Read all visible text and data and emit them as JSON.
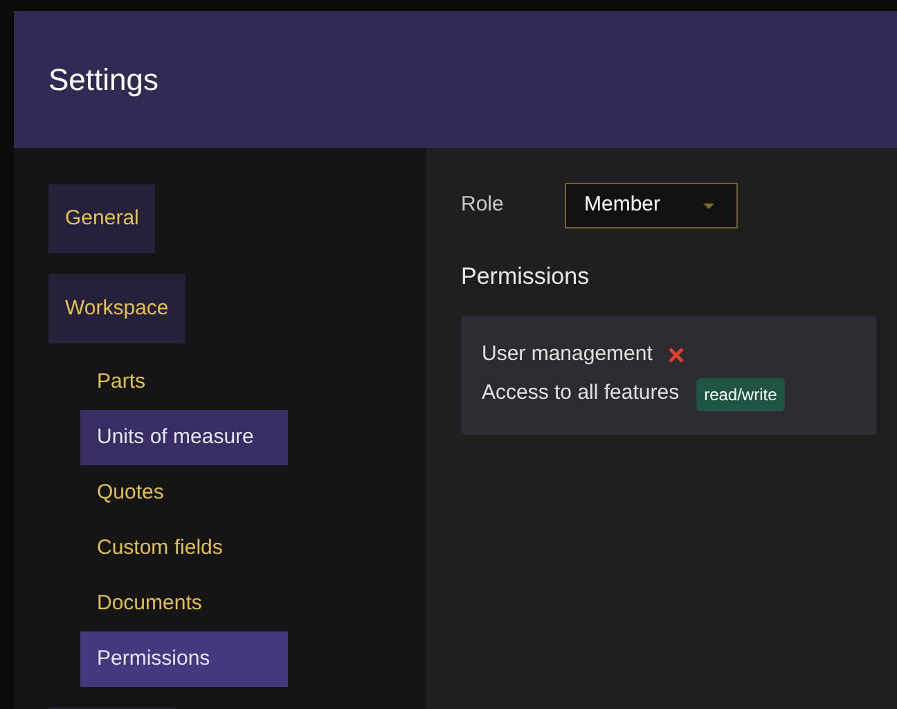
{
  "dialog": {
    "title": "Settings"
  },
  "sidebar": {
    "items": [
      {
        "label": "General",
        "selected": false
      },
      {
        "label": "Workspace",
        "selected": false,
        "children": [
          {
            "label": "Parts",
            "selected": false,
            "highlighted": false
          },
          {
            "label": "Units of measure",
            "selected": false,
            "highlighted": true
          },
          {
            "label": "Quotes",
            "selected": false,
            "highlighted": false
          },
          {
            "label": "Custom fields",
            "selected": false,
            "highlighted": false
          },
          {
            "label": "Documents",
            "selected": false,
            "highlighted": false
          },
          {
            "label": "Permissions",
            "selected": true,
            "highlighted": false
          }
        ]
      }
    ]
  },
  "role": {
    "label": "Role",
    "value": "Member"
  },
  "permissions": {
    "title": "Permissions",
    "items": [
      {
        "label": "User management",
        "kind": "denied"
      },
      {
        "label": "Access to all features",
        "kind": "badge",
        "badge": "read/write"
      }
    ]
  }
}
